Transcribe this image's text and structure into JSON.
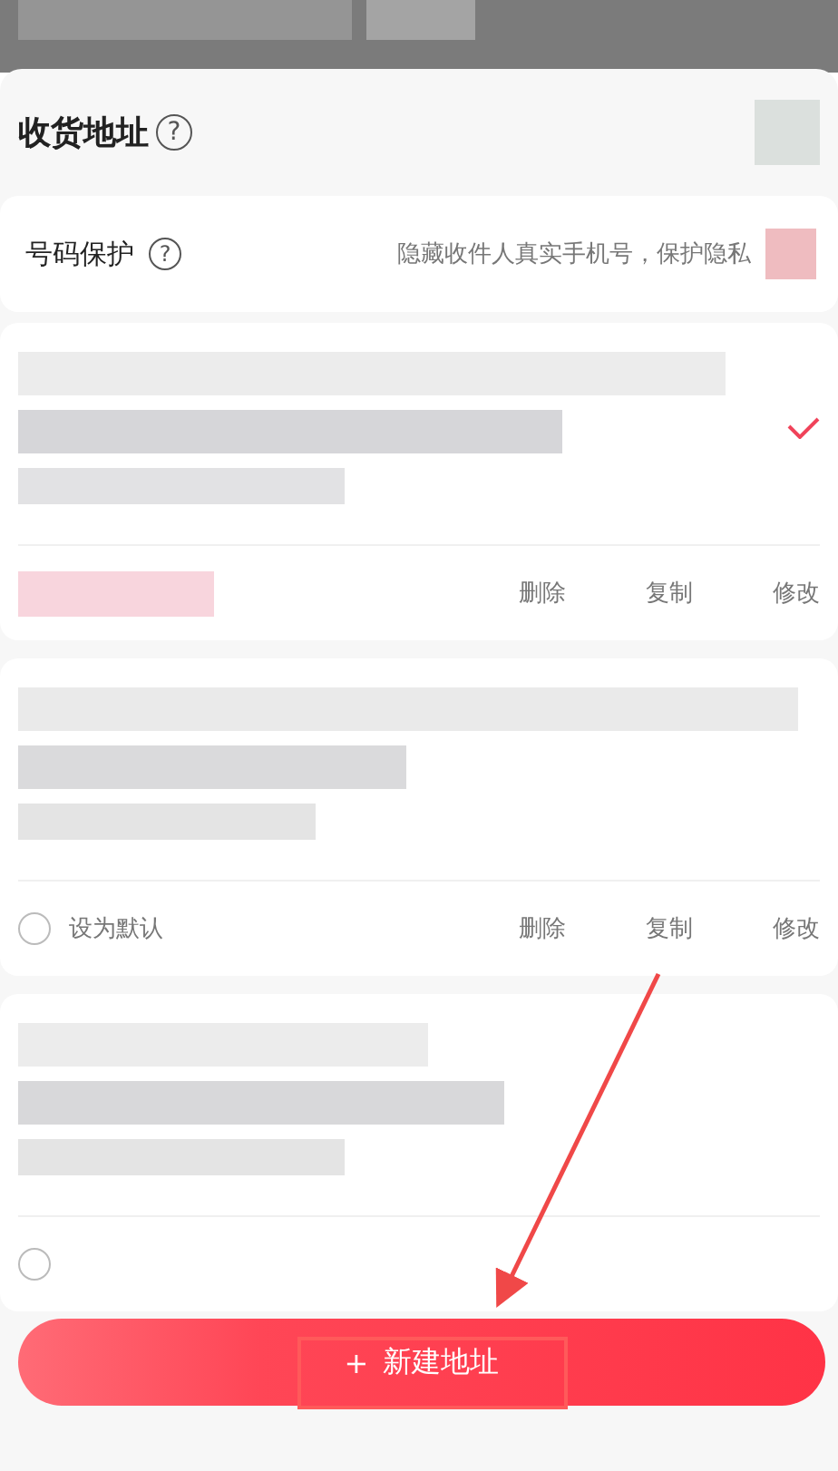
{
  "sheet": {
    "title": "收货地址",
    "help_icon": "?"
  },
  "privacy": {
    "label": "号码保护",
    "help_icon": "?",
    "description": "隐藏收件人真实手机号，保护隐私",
    "on": true
  },
  "addresses": [
    {
      "selected": true,
      "is_default": true,
      "actions": [
        "删除",
        "复制",
        "修改"
      ]
    },
    {
      "selected": false,
      "is_default": false,
      "default_label": "设为默认",
      "actions": [
        "删除",
        "复制",
        "修改"
      ]
    },
    {
      "is_default": false
    }
  ],
  "add_button": {
    "icon": "+",
    "label": "新建地址"
  },
  "annotations": {
    "arrow": true,
    "highlight_box": true
  }
}
